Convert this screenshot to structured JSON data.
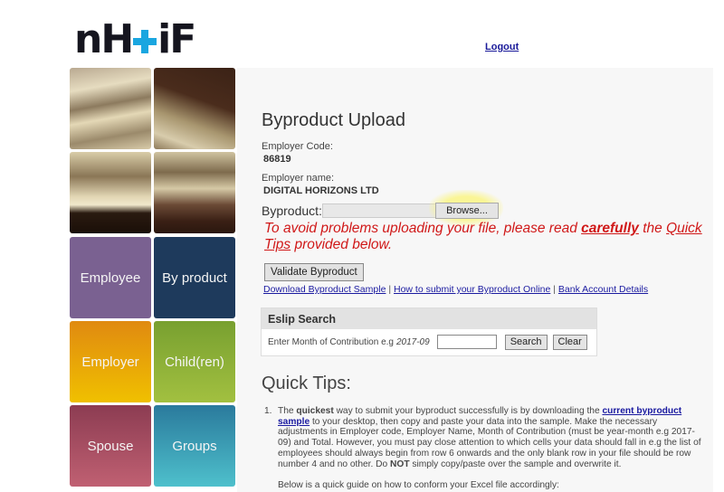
{
  "header": {
    "logo_text_left": "nH",
    "logo_text_right": "iF",
    "logout_label": "Logout"
  },
  "nav_tiles": [
    {
      "label": "Employee",
      "color": "#7a6191"
    },
    {
      "label": "By product",
      "color": "#1e3a5c"
    },
    {
      "label": "Employer",
      "color": "#e8a010"
    },
    {
      "label": "Child(ren)",
      "color": "#8cb038"
    },
    {
      "label": "Spouse",
      "color": "#a44c62"
    },
    {
      "label": "Groups",
      "color": "#3a9cb4"
    }
  ],
  "page": {
    "title": "Byproduct Upload",
    "employer_code_label": "Employer Code:",
    "employer_code": "86819",
    "employer_name_label": "Employer name:",
    "employer_name": "DIGITAL HORIZONS LTD",
    "byproduct_label": "Byproduct:",
    "browse_label": "Browse...",
    "file_value": "",
    "warning": {
      "part1": "To avoid problems uploading your file, please read ",
      "emphasis": "carefully",
      "part2": " the ",
      "link": "Quick Tips",
      "part3": " provided below."
    },
    "validate_label": "Validate Byproduct",
    "links": [
      "Download Byproduct Sample",
      "How to submit your Byproduct Online",
      "Bank Account Details"
    ],
    "link_separator": "|"
  },
  "eslip": {
    "title": "Eslip Search",
    "prompt": "Enter Month of Contribution e.g",
    "example": "2017-09",
    "input_value": "",
    "search_label": "Search",
    "clear_label": "Clear"
  },
  "quick_tips": {
    "title": "Quick Tips:",
    "items": [
      {
        "number": "1.",
        "t1": "The ",
        "b1": "quickest",
        "t2": " way to submit your byproduct successfully is by downloading the ",
        "link": "current byproduct sample",
        "t3": " to your desktop, then copy and paste your data into the sample. Make the necessary adjustments in Employer code, Employer Name, Month of Contribution (must be year-month e.g 2017-09) and Total. However, you must pay close attention to which cells your data should fall in e.g the list of employees should always begin from row 6 onwards and the only blank row in your file should be row number 4 and no other. Do ",
        "b2": "NOT",
        "t4": " simply copy/paste over the sample and overwrite it.",
        "after": "Below is a quick guide on how to conform your Excel file accordingly:"
      }
    ]
  }
}
